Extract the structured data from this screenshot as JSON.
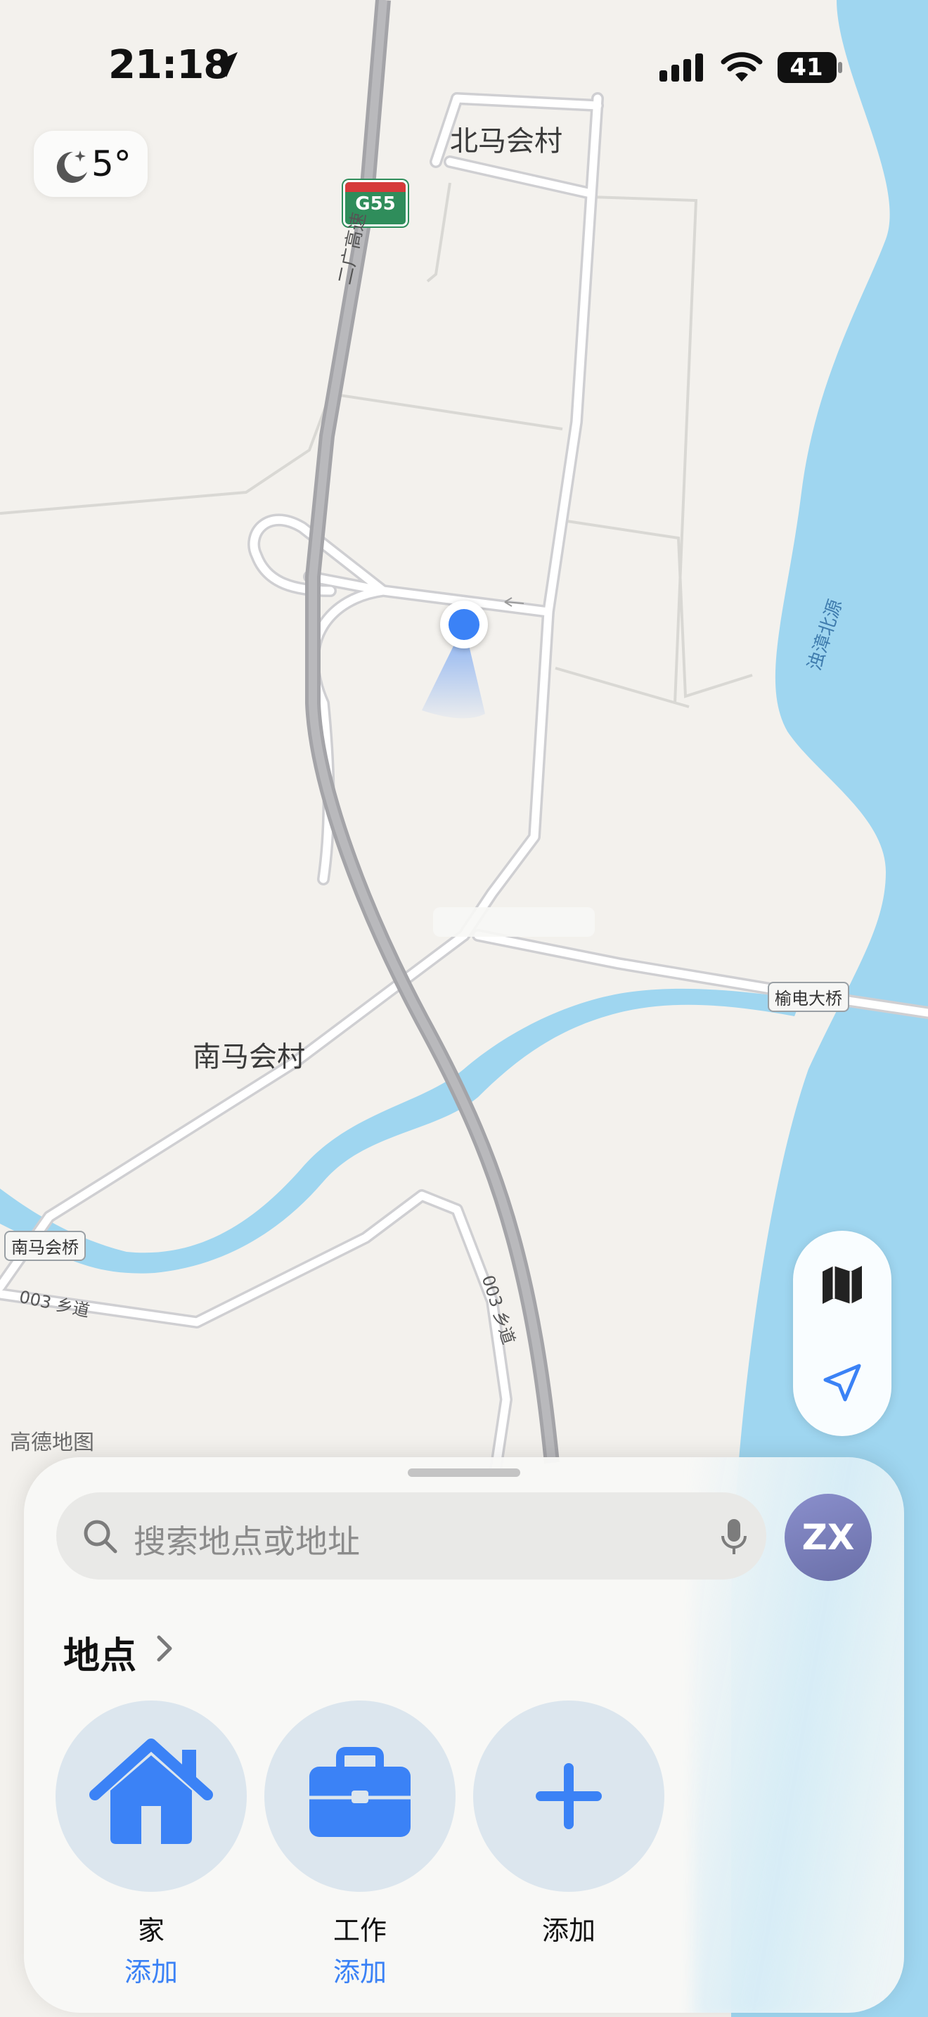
{
  "status_bar": {
    "time": "21:18",
    "battery": "41",
    "icons": [
      "location-arrow-icon",
      "cellular-signal-icon",
      "wifi-icon",
      "battery-icon"
    ]
  },
  "weather": {
    "icon": "moon-stars-icon",
    "temp": "5°"
  },
  "map": {
    "places": {
      "north_village": "北马会村",
      "south_village": "南马会村"
    },
    "bridges": {
      "yudian": "榆电大桥",
      "nanmahui": "南马会桥"
    },
    "roads": {
      "highway_name": "二广高速",
      "highway_shield": "G55",
      "county_road_a": "003 乡道",
      "county_road_b": "003 乡道"
    },
    "river": "浊漳北源",
    "watermark": "高德地图",
    "colors": {
      "land": "#f3f1ed",
      "water": "#9fd6f0",
      "road": "#c9c9cc",
      "highway": "#a3a3a6",
      "user_dot": "#3b82f6"
    }
  },
  "map_controls": {
    "map_mode_icon": "map-icon",
    "locate_icon": "location-arrow-icon"
  },
  "sheet": {
    "search_placeholder": "搜索地点或地址",
    "avatar_initials": "ZX",
    "section_title": "地点",
    "tiles": [
      {
        "icon": "home-icon",
        "title": "家",
        "action": "添加"
      },
      {
        "icon": "briefcase-icon",
        "title": "工作",
        "action": "添加"
      },
      {
        "icon": "plus-icon",
        "title": "添加",
        "action": ""
      }
    ]
  }
}
